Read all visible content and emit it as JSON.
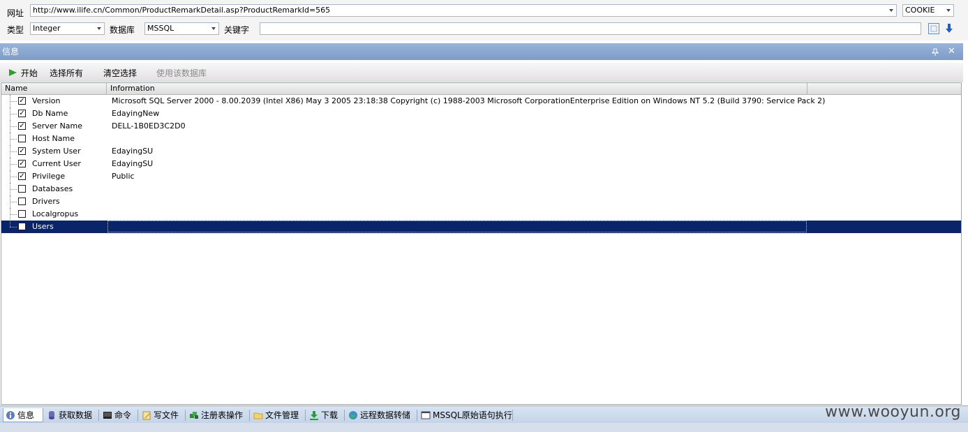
{
  "top": {
    "url_label": "网址",
    "url_value": "http://www.ilife.cn/Common/ProductRemarkDetail.asp?ProductRemarkId=565",
    "cookie_value": "COOKIE",
    "type_label": "类型",
    "type_value": "Integer",
    "db_label": "数据库",
    "db_value": "MSSQL",
    "keyword_label": "关键字",
    "keyword_value": ""
  },
  "panel": {
    "title": "信息"
  },
  "toolbar": {
    "start": "开始",
    "select_all": "选择所有",
    "clear_selection": "清空选择",
    "use_db": "使用该数据库"
  },
  "grid": {
    "columns": [
      "Name",
      "Information"
    ],
    "rows": [
      {
        "name": "Version",
        "info": "Microsoft SQL Server  2000 - 8.00.2039 (Intel X86) May  3 2005 23:18:38 Copyright (c) 1988-2003 Microsoft CorporationEnterprise Edition on Windows NT 5.2 (Build 3790: Service Pack 2)",
        "checked": true
      },
      {
        "name": "Db Name",
        "info": "EdayingNew",
        "checked": true
      },
      {
        "name": "Server Name",
        "info": "DELL-1B0ED3C2D0",
        "checked": true
      },
      {
        "name": "Host Name",
        "info": "",
        "checked": false
      },
      {
        "name": "System User",
        "info": "EdayingSU",
        "checked": true
      },
      {
        "name": "Current User",
        "info": "EdayingSU",
        "checked": true
      },
      {
        "name": "Privilege",
        "info": "Public",
        "checked": true
      },
      {
        "name": "Databases",
        "info": "",
        "checked": false
      },
      {
        "name": "Drivers",
        "info": "",
        "checked": false
      },
      {
        "name": "Localgropus",
        "info": "",
        "checked": false
      },
      {
        "name": "Users",
        "info": "",
        "checked": false,
        "selected": true
      }
    ]
  },
  "tabs": [
    {
      "label": "信息",
      "icon": "info-icon",
      "active": true
    },
    {
      "label": "获取数据",
      "icon": "database-icon"
    },
    {
      "label": "命令",
      "icon": "terminal-icon"
    },
    {
      "label": "写文件",
      "icon": "write-file-icon"
    },
    {
      "label": "注册表操作",
      "icon": "registry-icon"
    },
    {
      "label": "文件管理",
      "icon": "folder-icon"
    },
    {
      "label": "下载",
      "icon": "download-icon"
    },
    {
      "label": "远程数据转储",
      "icon": "globe-icon"
    },
    {
      "label": "MSSQL原始语句执行",
      "icon": "sql-icon"
    }
  ],
  "watermark": "www.wooyun.org",
  "colors": {
    "selection": "#0a246a",
    "panel_title": "#7d9cc8",
    "tab_bar": "#c3d3e8"
  }
}
